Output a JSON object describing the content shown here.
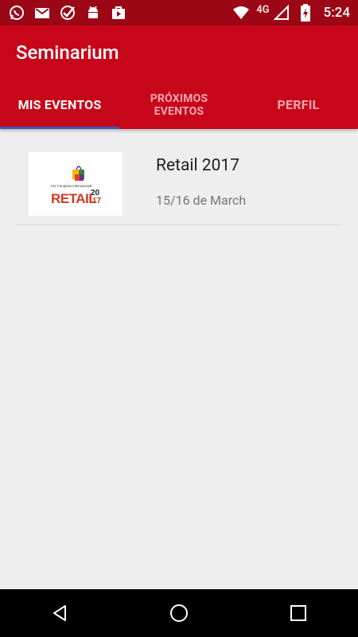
{
  "status_bar": {
    "time": "5:24",
    "network": "4G",
    "left_icons": [
      "whatsapp-icon",
      "gmail-icon",
      "check-icon",
      "android-icon",
      "play-store-icon"
    ],
    "right_icons": [
      "wifi-icon",
      "signal-icon",
      "battery-icon"
    ]
  },
  "app": {
    "title": "Seminarium"
  },
  "tabs": [
    {
      "label": "MIS EVENTOS",
      "active": true
    },
    {
      "label_line1": "PRÓXIMOS",
      "label_line2": "EVENTOS",
      "active": false
    },
    {
      "label": "PERFIL",
      "active": false
    }
  ],
  "events": [
    {
      "title": "Retail 2017",
      "date": "15/16 de March",
      "logo": {
        "caption": "XIV Congreso Internacional",
        "word": "RETAIL",
        "year_top": "20",
        "year_bottom": "17"
      }
    }
  ],
  "colors": {
    "status_bar": "#9b0714",
    "app_bar": "#c8061a",
    "tab_indicator": "#3f51b5",
    "background": "#eeeeee"
  },
  "nav_bar": [
    "back-icon",
    "home-icon",
    "recents-icon"
  ]
}
